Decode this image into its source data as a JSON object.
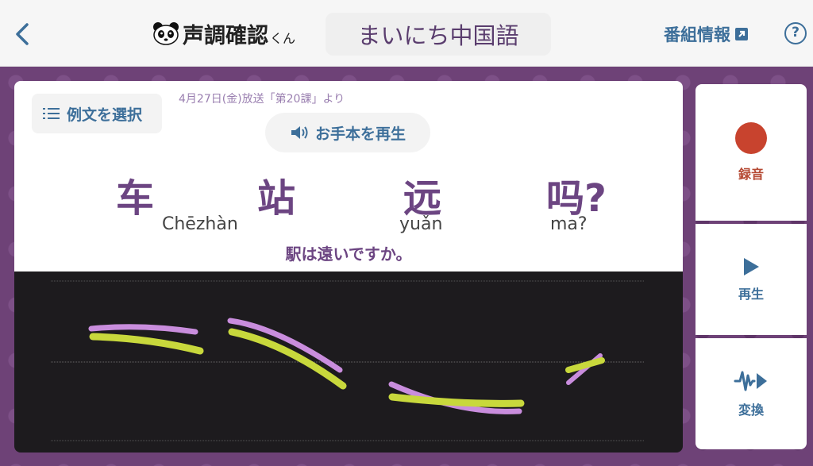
{
  "header": {
    "app_title": "声調確認",
    "app_suffix": "くん",
    "show_title": "まいにち中国語",
    "program_info": "番組情報",
    "help": "?"
  },
  "card": {
    "select_sentence": "例文を選択",
    "broadcast_info": "4月27日(金)放送「第20課」より",
    "play_model": "お手本を再生",
    "hanzi": [
      "车",
      "站",
      "远",
      "吗?"
    ],
    "pinyin": [
      "Chēzhàn",
      "yuǎn",
      "ma?"
    ],
    "translation": "駅は遠いですか。"
  },
  "side": {
    "record": "録音",
    "play": "再生",
    "convert": "変換"
  },
  "colors": {
    "accent_blue": "#3d6f9a",
    "purple": "#6c4582",
    "record_red": "#c8432e",
    "model_curve": "#c98ddd",
    "user_curve": "#c8d83c"
  },
  "icons": [
    "back-chevron-icon",
    "panda-icon",
    "external-link-icon",
    "help-icon",
    "list-icon",
    "speaker-icon",
    "record-icon",
    "play-icon",
    "waveform-play-icon"
  ]
}
